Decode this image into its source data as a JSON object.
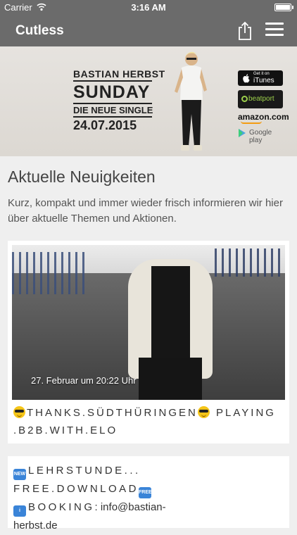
{
  "status_bar": {
    "carrier": "Carrier",
    "time": "3:16 AM",
    "battery_level": 1.0
  },
  "nav": {
    "title": "Cutless"
  },
  "banner": {
    "artist": "BASTIAN HERBST",
    "title": "SUNDAY",
    "subtitle": "DIE NEUE SINGLE",
    "date": "24.07.2015",
    "stores": {
      "itunes_small": "Get it on",
      "itunes_large": "iTunes",
      "beatport": "beatport",
      "amazon": "amazon.com",
      "googleplay": "Google play"
    }
  },
  "main": {
    "heading": "Aktuelle Neuigkeiten",
    "intro": "Kurz, kompakt und immer wieder frisch informieren wir hier über aktuelle Themen und Aktionen."
  },
  "posts": [
    {
      "timestamp": "27. Februar um 20:22 Uhr",
      "text_line1": "THANKS.SÜDTHÜRINGEN",
      "text_line1_tail": " PLAYING",
      "text_line2": ".B2B.WITH.ELO"
    },
    {
      "new_badge": "NEW",
      "free_badge": "FREE",
      "info_badge": "i",
      "line1": "LEHRSTUNDE...",
      "line2": "FREE.DOWNLOAD",
      "booking_label": "BOOKING",
      "booking_value": ": info@bastian-",
      "line4": "herbst.de"
    }
  ],
  "colors": {
    "navbar": "#6b6b6b",
    "background": "#efefef",
    "card": "#ffffff"
  }
}
